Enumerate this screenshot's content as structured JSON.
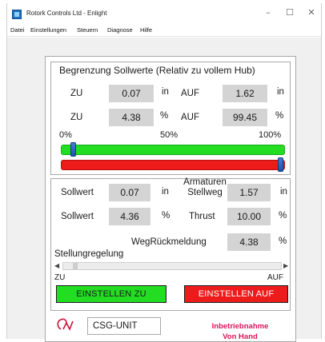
{
  "window": {
    "title": "Rotork Controls Ltd - Enlight",
    "controls": {
      "minimize": "–",
      "maximize": "☐",
      "close": "✕"
    }
  },
  "menu": [
    "Datei",
    "Einstellungen",
    "Steuern",
    "Diagnose",
    "Hilfe"
  ],
  "limits": {
    "title": "Begrenzung Sollwerte (Relativ zu vollem Hub)",
    "rows": [
      {
        "label_left": "ZU",
        "value_left": "0.07",
        "unit_left": "in",
        "label_right": "AUF",
        "value_right": "1.62",
        "unit_right": "in"
      },
      {
        "label_left": "ZU",
        "value_left": "4.38",
        "unit_left": "%",
        "label_right": "AUF",
        "value_right": "99.45",
        "unit_right": "%"
      }
    ],
    "scale": [
      "0%",
      "50%",
      "100%"
    ],
    "green_slider_percent": 4.38,
    "red_slider_percent": 99.45
  },
  "position": {
    "sollwert_in_label": "Sollwert",
    "sollwert_in_value": "0.07",
    "sollwert_in_unit": "in",
    "stellweg_label_1": "Armaturen",
    "stellweg_label_2": "Stellweg",
    "stellweg_value": "1.57",
    "stellweg_unit": "in",
    "sollwert_pct_label": "Sollwert",
    "sollwert_pct_value": "4.36",
    "sollwert_pct_unit": "%",
    "thrust_label": "Thrust",
    "thrust_value": "10.00",
    "thrust_unit": "%",
    "feedback_label": "WegRückmeldung",
    "feedback_value": "4.38",
    "feedback_unit": "%",
    "control_label": "Stellungregelung",
    "scroll_min": "ZU",
    "scroll_max": "AUF",
    "scroll_percent": 4.36,
    "btn_close": "EINSTELLEN ZU",
    "btn_open": "EINSTELLEN AUF"
  },
  "footer": {
    "unit_name": "CSG-UNIT",
    "status_line1": "Inbetriebnahme",
    "status_line2": "Von Hand"
  },
  "colors": {
    "green": "#22dd22",
    "red": "#ee1b1b",
    "status": "#e0105a",
    "value_box": "#d4d4d4"
  }
}
